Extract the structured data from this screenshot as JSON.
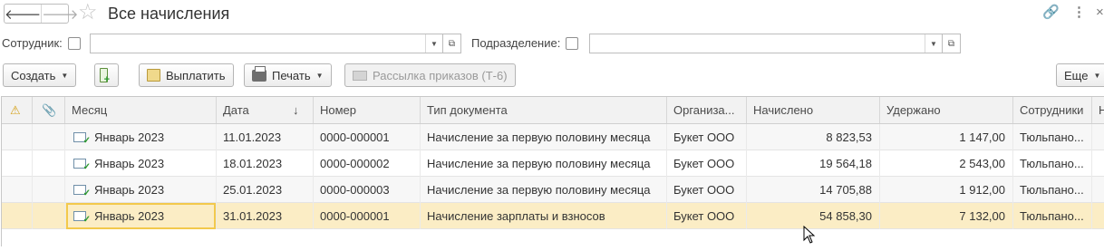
{
  "window": {
    "title": "Все начисления",
    "nav_back": "🡐",
    "nav_forward": "🡒",
    "favorite_icon": "☆",
    "link_icon": "🔗",
    "more_icon": "⋮",
    "close_icon": "×"
  },
  "filters": {
    "employee_label": "Сотрудник:",
    "department_label": "Подразделение:",
    "dropdown_glyph": "▼",
    "open_glyph": "⧉"
  },
  "toolbar": {
    "create_label": "Создать",
    "pay_label": "Выплатить",
    "print_label": "Печать",
    "mailing_label": "Рассылка приказов (Т-6)",
    "more_label": "Еще",
    "caret": "▼"
  },
  "table": {
    "columns": [
      "",
      "",
      "Месяц",
      "Дата",
      "Номер",
      "Тип документа",
      "Организа...",
      "Начислено",
      "Удержано",
      "Сотрудники",
      "Н"
    ],
    "sort_indicator": "↓",
    "warning_icon": "⚠",
    "attach_icon": "📎",
    "rows": [
      {
        "month": "Январь 2023",
        "date": "11.01.2023",
        "number": "0000-000001",
        "doc_type": "Начисление за первую половину месяца",
        "org": "Букет ООО",
        "accrued": "8 823,53",
        "withheld": "1 147,00",
        "employees": "Тюльпано..."
      },
      {
        "month": "Январь 2023",
        "date": "18.01.2023",
        "number": "0000-000002",
        "doc_type": "Начисление за первую половину месяца",
        "org": "Букет ООО",
        "accrued": "19 564,18",
        "withheld": "2 543,00",
        "employees": "Тюльпано..."
      },
      {
        "month": "Январь 2023",
        "date": "25.01.2023",
        "number": "0000-000003",
        "doc_type": "Начисление за первую половину месяца",
        "org": "Букет ООО",
        "accrued": "14 705,88",
        "withheld": "1 912,00",
        "employees": "Тюльпано..."
      },
      {
        "month": "Январь 2023",
        "date": "31.01.2023",
        "number": "0000-000001",
        "doc_type": "Начисление зарплаты и взносов",
        "org": "Букет ООО",
        "accrued": "54 858,30",
        "withheld": "7 132,00",
        "employees": "Тюльпано..."
      }
    ]
  },
  "colors": {
    "selected_row": "#fbedc5",
    "selected_border": "#f2c94c",
    "header_bg": "#f2f2f2"
  }
}
